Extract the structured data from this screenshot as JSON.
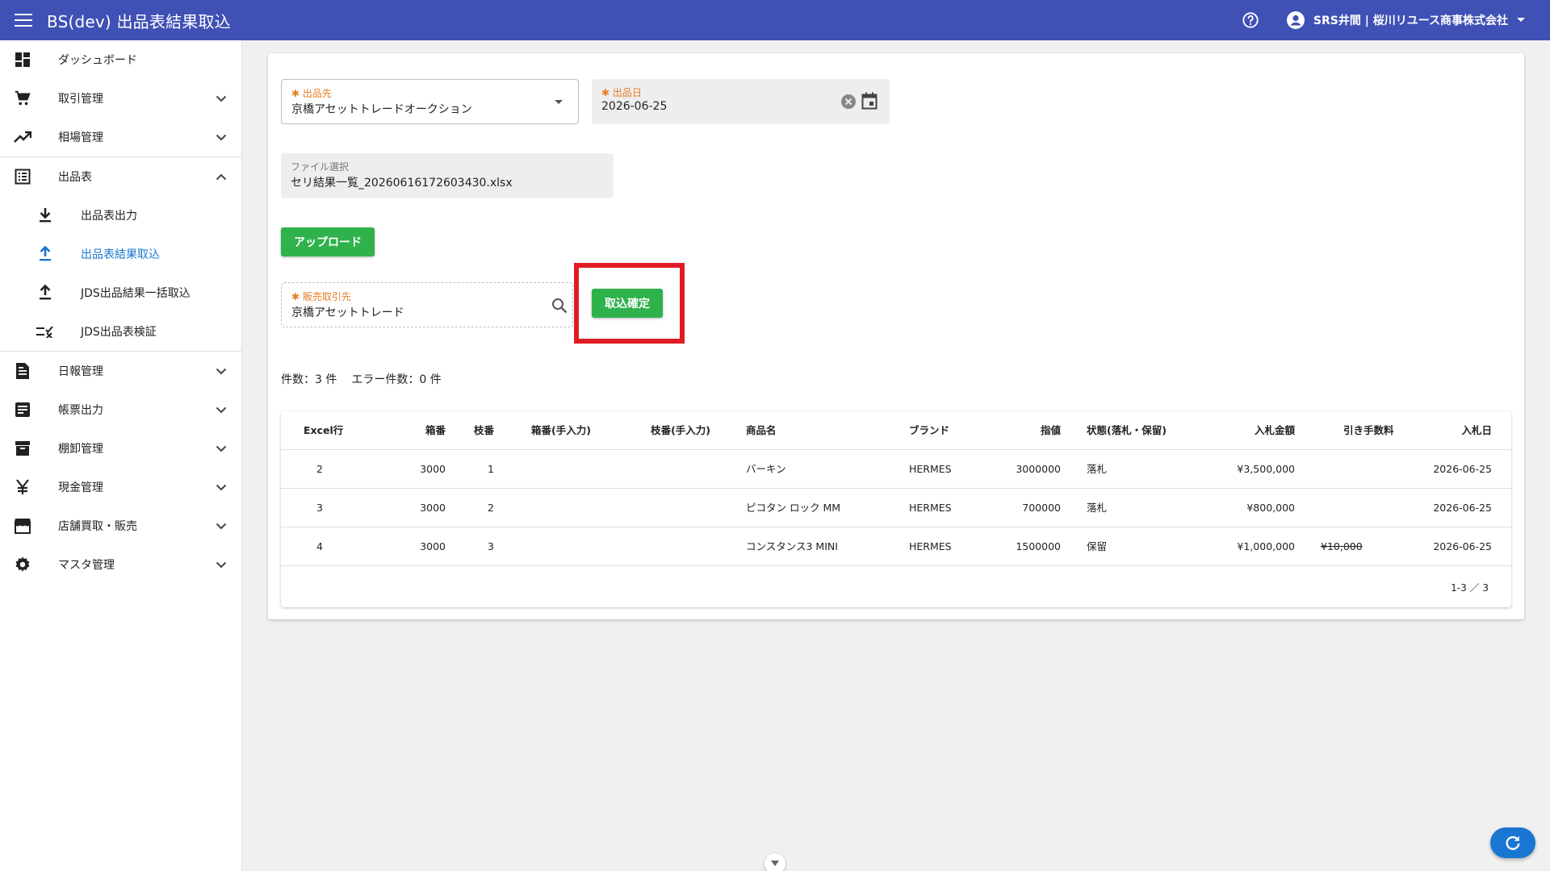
{
  "header": {
    "title": "BS(dev) 出品表結果取込",
    "user": "SRS井間 | 桜川リユース商事株式会社"
  },
  "sidebar": {
    "items": [
      {
        "label": "ダッシュボード",
        "icon": "dashboard-icon"
      },
      {
        "label": "取引管理",
        "icon": "cart-icon"
      },
      {
        "label": "相場管理",
        "icon": "trending-up-icon"
      },
      {
        "label": "出品表",
        "icon": "list-icon"
      },
      {
        "label": "出品表出力",
        "icon": "download-icon"
      },
      {
        "label": "出品表結果取込",
        "icon": "upload-icon"
      },
      {
        "label": "JDS出品結果一括取込",
        "icon": "upload-icon"
      },
      {
        "label": "JDS出品表検証",
        "icon": "checklist-icon"
      },
      {
        "label": "日報管理",
        "icon": "document-icon"
      },
      {
        "label": "帳票出力",
        "icon": "form-icon"
      },
      {
        "label": "棚卸管理",
        "icon": "archive-icon"
      },
      {
        "label": "現金管理",
        "icon": "yen-icon"
      },
      {
        "label": "店舗買取・販売",
        "icon": "store-icon"
      },
      {
        "label": "マスタ管理",
        "icon": "gear-icon"
      }
    ]
  },
  "form": {
    "destination_label": "出品先",
    "destination_value": "京橋アセットトレードオークション",
    "date_label": "出品日",
    "date_value": "2026-06-25",
    "file_label": "ファイル選択",
    "file_value": "セリ結果一覧_20260616172603430.xlsx",
    "upload_label": "アップロード",
    "partner_label": "販売取引先",
    "partner_value": "京橋アセットトレード",
    "confirm_label": "取込確定"
  },
  "summary": {
    "count": "件数：3 件",
    "errors": "エラー件数：0 件"
  },
  "table": {
    "headers": [
      "Excel行",
      "箱番",
      "枝番",
      "箱番(手入力)",
      "枝番(手入力)",
      "商品名",
      "ブランド",
      "指値",
      "状態(落札・保留)",
      "入札金額",
      "引き手数料",
      "入札日"
    ],
    "rows": [
      {
        "row": "2",
        "box": "3000",
        "branch": "1",
        "box_manual": "",
        "branch_manual": "",
        "product": "バーキン",
        "brand": "HERMES",
        "limit": "3000000",
        "status": "落札",
        "bid": "¥3,500,000",
        "fee": "",
        "date": "2026-06-25"
      },
      {
        "row": "3",
        "box": "3000",
        "branch": "2",
        "box_manual": "",
        "branch_manual": "",
        "product": "ピコタン ロック MM",
        "brand": "HERMES",
        "limit": "700000",
        "status": "落札",
        "bid": "¥800,000",
        "fee": "",
        "date": "2026-06-25"
      },
      {
        "row": "4",
        "box": "3000",
        "branch": "3",
        "box_manual": "",
        "branch_manual": "",
        "product": "コンスタンス3 MINI",
        "brand": "HERMES",
        "limit": "1500000",
        "status": "保留",
        "bid": "¥1,000,000",
        "fee": "¥10,000",
        "date": "2026-06-25"
      }
    ],
    "pagination": "1-3 ／ 3"
  },
  "colors": {
    "header_bg": "#3f51b5",
    "accent_green": "#2fb24c",
    "highlight_red": "#e01b24",
    "active_blue": "#1976d2"
  }
}
